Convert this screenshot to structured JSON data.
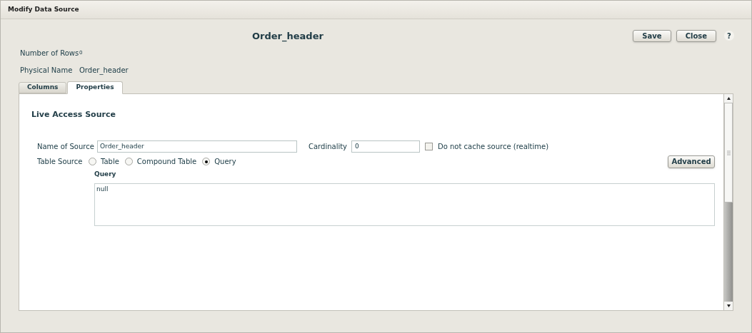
{
  "window": {
    "title": "Modify Data Source"
  },
  "heading": "Order_header",
  "buttons": [
    {
      "kind": "save",
      "label": "Save"
    },
    {
      "kind": "close",
      "label": "Close"
    },
    {
      "kind": "help",
      "label": "?"
    }
  ],
  "info": [
    {
      "label": "Number of Rows",
      "value": "0"
    },
    {
      "label": "Physical Name",
      "value": "Order_header"
    }
  ],
  "tabs": [
    {
      "label": "Columns",
      "selected": false
    },
    {
      "label": "Properties",
      "selected": true
    }
  ],
  "section_title": "Live Access Source",
  "name_of_source": {
    "label": "Name of Source",
    "value": "Order_header"
  },
  "cardinality": {
    "label": "Cardinality",
    "value": "0"
  },
  "no_cache": {
    "label": "Do not cache source (realtime)",
    "checked": false
  },
  "table_source": {
    "label": "Table Source",
    "options": [
      {
        "label": "Table",
        "selected": false
      },
      {
        "label": "Compound Table",
        "selected": false
      },
      {
        "label": "Query",
        "selected": true
      }
    ]
  },
  "advanced_button": "Advanced",
  "query": {
    "label": "Query",
    "value": "null"
  }
}
